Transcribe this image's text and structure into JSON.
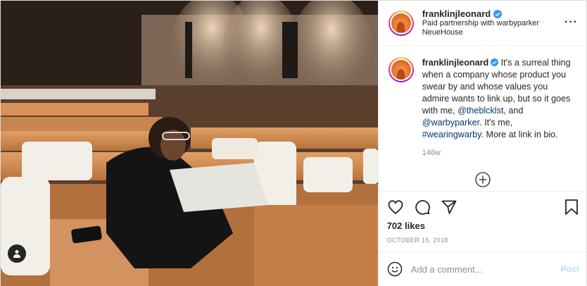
{
  "post": {
    "username": "franklinjleonard",
    "partnership_prefix": "Paid partnership with",
    "partner": "warbyparker",
    "location": "NeueHouse",
    "more_icon": "more-options-icon"
  },
  "caption": {
    "username": "franklinjleonard",
    "text_1": " It's a surreal thing when a company whose product you swear by and whose values you admire wants to link up, but so it goes with me, ",
    "mention_1": "@theblcklst",
    "text_2": ", and ",
    "mention_2": "@warbyparker",
    "text_3": ". It's me, ",
    "hashtag": "#wearingwarby",
    "text_4": ". More at link in bio.",
    "time": "146w"
  },
  "engagement": {
    "likes": "702 likes",
    "date": "OCTOBER 16, 2018"
  },
  "comment_box": {
    "placeholder": "Add a comment...",
    "post_label": "Post"
  },
  "colors": {
    "link": "#00376b",
    "verified": "#3897f0",
    "post_disabled": "#b2dffc"
  }
}
